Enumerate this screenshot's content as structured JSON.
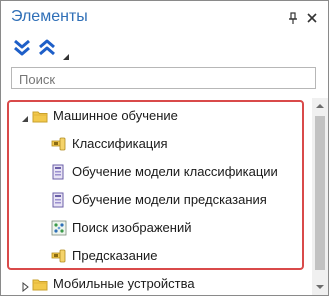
{
  "panel": {
    "title": "Элементы",
    "pin_icon": "pin-icon",
    "close_icon": "close-icon"
  },
  "toolbar": {
    "expand_all_icon": "expand-all-icon",
    "collapse_all_icon": "collapse-all-icon",
    "dropdown_icon": "dropdown-arrow-icon"
  },
  "search": {
    "placeholder": "Поиск",
    "value": ""
  },
  "tree": {
    "group": {
      "label": "Машинное обучение",
      "icon": "folder-icon",
      "expanded": true,
      "items": [
        {
          "label": "Классификация",
          "icon": "classification-icon"
        },
        {
          "label": "Обучение модели классификации",
          "icon": "train-model-icon"
        },
        {
          "label": "Обучение модели предсказания",
          "icon": "train-model-icon"
        },
        {
          "label": "Поиск изображений",
          "icon": "image-search-icon"
        },
        {
          "label": "Предсказание",
          "icon": "prediction-icon"
        }
      ]
    },
    "next_group": {
      "label": "Мобильные устройства",
      "icon": "folder-icon",
      "expanded": false
    }
  },
  "colors": {
    "title": "#2f6fb7",
    "highlight_border": "#d94a4a",
    "folder": "#f2c94c",
    "toolbar_icon": "#1e5fc8"
  }
}
